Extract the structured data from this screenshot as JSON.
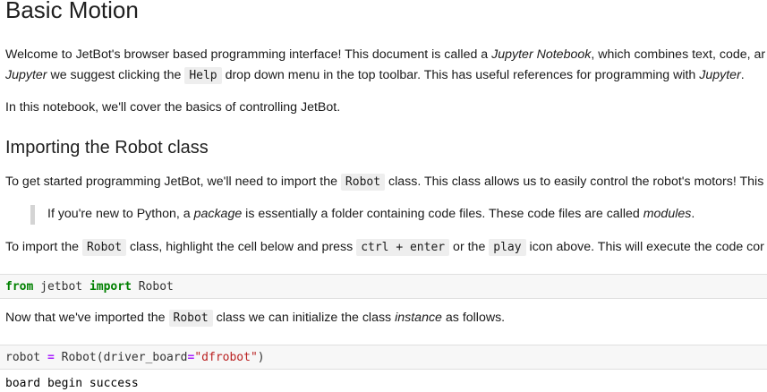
{
  "notebook": {
    "title": "Basic Motion",
    "intro": {
      "l1_a": "Welcome to JetBot's browser based programming interface! This document is called a ",
      "l1_em": "Jupyter Notebook",
      "l1_b": ", which combines text, code, ar",
      "l2_em1": "Jupyter",
      "l2_a": " we suggest clicking the ",
      "l2_code": "Help",
      "l2_b": " drop down menu in the top toolbar. This has useful references for programming with ",
      "l2_em2": "Jupyter",
      "l2_c": "."
    },
    "p_cover": "In this notebook, we'll cover the basics of controlling JetBot.",
    "h_import": "Importing the Robot class",
    "p_start": {
      "a": "To get started programming JetBot, we'll need to import the ",
      "code": "Robot",
      "b": " class. This class allows us to easily control the robot's motors! This"
    },
    "quote": {
      "a": "If you're new to Python, a ",
      "em1": "package",
      "b": " is essentially a folder containing code files. These code files are called ",
      "em2": "modules",
      "c": "."
    },
    "p_toimport": {
      "a": "To import the ",
      "code1": "Robot",
      "b": " class, highlight the cell below and press ",
      "code2": "ctrl + enter",
      "c": " or the ",
      "code3": "play",
      "d": " icon above. This will execute the code cor"
    },
    "cell1": {
      "kw1": "from",
      "mod": " jetbot ",
      "kw2": "import",
      "name": " Robot"
    },
    "p_now": {
      "a": "Now that we've imported the ",
      "code": "Robot",
      "b": " class we can initialize the class ",
      "em": "instance",
      "c": " as follows."
    },
    "cell2": {
      "var": "robot ",
      "op1": "=",
      "call": " Robot(driver_board",
      "op2": "=",
      "str": "\"dfrobot\"",
      "end": ")"
    },
    "output": "board begin success"
  }
}
